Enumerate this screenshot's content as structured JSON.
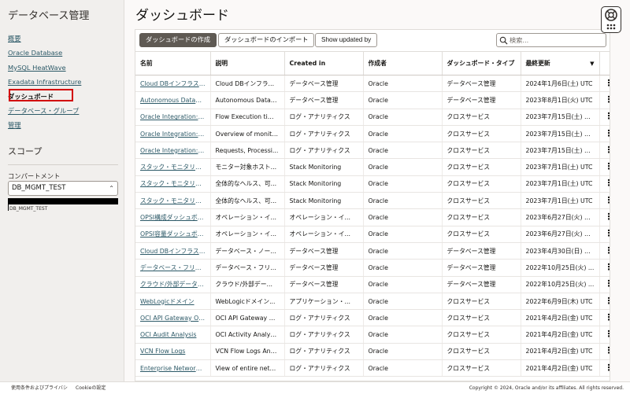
{
  "sidebar": {
    "title": "データベース管理",
    "items": [
      {
        "label": "概要"
      },
      {
        "label": "Oracle Database"
      },
      {
        "label": "MySQL HeatWave"
      },
      {
        "label": "Exadata Infrastructure"
      },
      {
        "label": "ダッシュボード",
        "active": true
      },
      {
        "label": "データベース・グループ"
      },
      {
        "label": "管理"
      }
    ],
    "scope_heading": "スコープ",
    "compartment_label": "コンパートメント",
    "compartment_value": "DB_MGMT_TEST",
    "compartment_path": "DB_MGMT_TEST"
  },
  "main": {
    "title": "ダッシュボード",
    "toolbar": {
      "create_label": "ダッシュボードの作成",
      "import_label": "ダッシュボードのインポート",
      "show_updated_label": "Show updated by"
    },
    "search": {
      "placeholder": "検索..."
    }
  },
  "table": {
    "headers": [
      "名前",
      "説明",
      "Created in",
      "作成者",
      "ダッシュボード・タイプ",
      "最終更新"
    ],
    "rows": [
      {
        "name": "Cloud DBインフラストラクチャ",
        "desc": "Cloud DBインフラストラクチャ",
        "created_in": "データベース管理",
        "creator": "Oracle",
        "type": "データベース管理",
        "updated": "2024年1月6日(土) UTC"
      },
      {
        "name": "Autonomous Database",
        "desc": "Autonomous Database",
        "created_in": "データベース管理",
        "creator": "Oracle",
        "type": "データベース管理",
        "updated": "2023年8月1日(火) UTC"
      },
      {
        "name": "Oracle Integration: Flow",
        "desc": "Flow Execution time...",
        "created_in": "ログ・アナリティクス",
        "creator": "Oracle",
        "type": "クロスサービス",
        "updated": "2023年7月15日(土) U..."
      },
      {
        "name": "Oracle Integration: Overview",
        "desc": "Overview of monitor...",
        "created_in": "ログ・アナリティクス",
        "creator": "Oracle",
        "type": "クロスサービス",
        "updated": "2023年7月15日(土) U..."
      },
      {
        "name": "Oracle Integration: Requests",
        "desc": "Requests, Processi...",
        "created_in": "ログ・アナリティクス",
        "creator": "Oracle",
        "type": "クロスサービス",
        "updated": "2023年7月15日(土) U..."
      },
      {
        "name": "スタック・モニタリング",
        "desc": "モニター対象ホスト...",
        "created_in": "Stack Monitoring",
        "creator": "Oracle",
        "type": "クロスサービス",
        "updated": "2023年7月1日(土) UTC"
      },
      {
        "name": "スタック・モニタリング",
        "desc": "全体的なヘルス、可...",
        "created_in": "Stack Monitoring",
        "creator": "Oracle",
        "type": "クロスサービス",
        "updated": "2023年7月1日(土) UTC"
      },
      {
        "name": "スタック・モニタリング",
        "desc": "全体的なヘルス、可...",
        "created_in": "Stack Monitoring",
        "creator": "Oracle",
        "type": "クロスサービス",
        "updated": "2023年7月1日(土) UTC"
      },
      {
        "name": "OPSI構成ダッシュボード",
        "desc": "オペレーション・イ...",
        "created_in": "オペレーション・イ...",
        "creator": "Oracle",
        "type": "クロスサービス",
        "updated": "2023年6月27日(火) U..."
      },
      {
        "name": "OPSI容量ダッシュボード",
        "desc": "オペレーション・イ...",
        "created_in": "オペレーション・イ...",
        "creator": "Oracle",
        "type": "クロスサービス",
        "updated": "2023年6月27日(火) U..."
      },
      {
        "name": "Cloud DBインフラストラクチャ",
        "desc": "データベース・ノー...",
        "created_in": "データベース管理",
        "creator": "Oracle",
        "type": "データベース管理",
        "updated": "2023年4月30日(日) U..."
      },
      {
        "name": "データベース・フリート",
        "desc": "データベース・フリ...",
        "created_in": "データベース管理",
        "creator": "Oracle",
        "type": "データベース管理",
        "updated": "2022年10月25日(火) ..."
      },
      {
        "name": "クラウド/外部データベース",
        "desc": "クラウド/外部デー...",
        "created_in": "データベース管理",
        "creator": "Oracle",
        "type": "データベース管理",
        "updated": "2022年10月25日(火) ..."
      },
      {
        "name": "WebLogicドメイン",
        "desc": "WebLogicドメイン...",
        "created_in": "アプリケーション・...",
        "creator": "Oracle",
        "type": "クロスサービス",
        "updated": "2022年6月9日(木) UTC"
      },
      {
        "name": "OCI API Gateway Overview",
        "desc": "OCI API Gateway O...",
        "created_in": "ログ・アナリティクス",
        "creator": "Oracle",
        "type": "クロスサービス",
        "updated": "2021年4月2日(金) UTC"
      },
      {
        "name": "OCI Audit Analysis",
        "desc": "OCI Activity Analysis...",
        "created_in": "ログ・アナリティクス",
        "creator": "Oracle",
        "type": "クロスサービス",
        "updated": "2021年4月2日(金) UTC"
      },
      {
        "name": "VCN Flow Logs",
        "desc": "VCN Flow Logs Ana...",
        "created_in": "ログ・アナリティクス",
        "creator": "Oracle",
        "type": "クロスサービス",
        "updated": "2021年4月2日(金) UTC"
      },
      {
        "name": "Enterprise Network Overview",
        "desc": "View of entire network",
        "created_in": "ログ・アナリティクス",
        "creator": "Oracle",
        "type": "クロスサービス",
        "updated": "2021年4月2日(金) UTC"
      }
    ]
  },
  "footer": {
    "terms": "使用条件およびプライバシ",
    "cookies": "Cookieの設定",
    "copyright": "Copyright © 2024, Oracle and/or its affiliates. All rights reserved."
  },
  "colors": {
    "link": "#2c5967",
    "primary_button": "#5f5a54",
    "highlight": "#d20000",
    "sidebar_bg": "#f1efed"
  }
}
